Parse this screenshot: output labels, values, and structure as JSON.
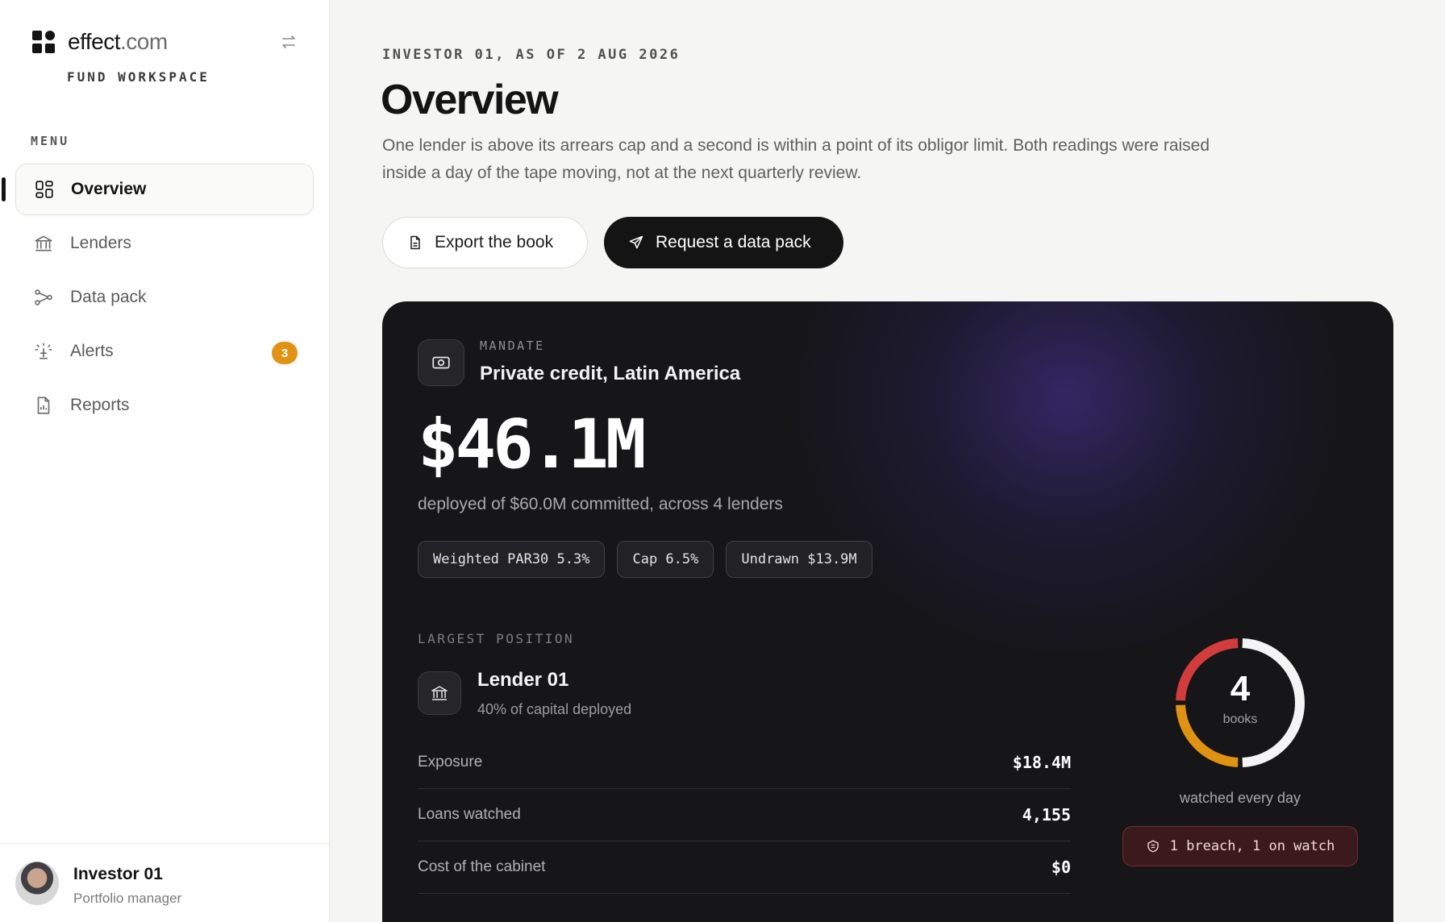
{
  "brand": {
    "name": "effect",
    "tld": ".com",
    "subtitle": "FUND WORKSPACE"
  },
  "sidebar": {
    "menu_label": "MENU",
    "items": [
      {
        "label": "Overview",
        "icon": "grid-icon",
        "active": true
      },
      {
        "label": "Lenders",
        "icon": "bank-icon"
      },
      {
        "label": "Data pack",
        "icon": "share-nodes-icon"
      },
      {
        "label": "Alerts",
        "icon": "beacon-icon",
        "badge": "3"
      },
      {
        "label": "Reports",
        "icon": "report-file-icon"
      }
    ]
  },
  "user": {
    "name": "Investor 01",
    "role": "Portfolio manager"
  },
  "header": {
    "eyebrow": "INVESTOR 01, AS OF 2 AUG 2026",
    "title": "Overview",
    "description": "One lender is above its arrears cap and a second is within a point of its obligor limit. Both readings were raised inside a day of the tape moving, not at the next quarterly review."
  },
  "actions": {
    "export_label": "Export the book",
    "request_label": "Request a data pack"
  },
  "card": {
    "mandate_label": "MANDATE",
    "mandate_value": "Private credit, Latin America",
    "deployed": "$46.1M",
    "deployed_sub": "deployed of $60.0M committed, across 4 lenders",
    "chips": [
      "Weighted PAR30 5.3%",
      "Cap 6.5%",
      "Undrawn $13.9M"
    ],
    "largest_label": "LARGEST POSITION",
    "lender_name": "Lender 01",
    "lender_sub": "40% of capital deployed",
    "stats": [
      {
        "label": "Exposure",
        "value": "$18.4M"
      },
      {
        "label": "Loans watched",
        "value": "4,155"
      },
      {
        "label": "Cost of the cabinet",
        "value": "$0"
      }
    ],
    "donut": {
      "count": "4",
      "unit": "books",
      "caption": "watched every day",
      "segments": [
        {
          "status": "ok",
          "fraction": 0.5,
          "color": "#f4f4f4"
        },
        {
          "status": "watch",
          "fraction": 0.25,
          "color": "#e09213"
        },
        {
          "status": "breach",
          "fraction": 0.25,
          "color": "#d23c3c"
        }
      ]
    },
    "alert_pill": "1 breach, 1 on watch"
  },
  "colors": {
    "accent": "#141414",
    "badge": "#e09213",
    "breach": "#d23c3c",
    "watch": "#e09213"
  }
}
